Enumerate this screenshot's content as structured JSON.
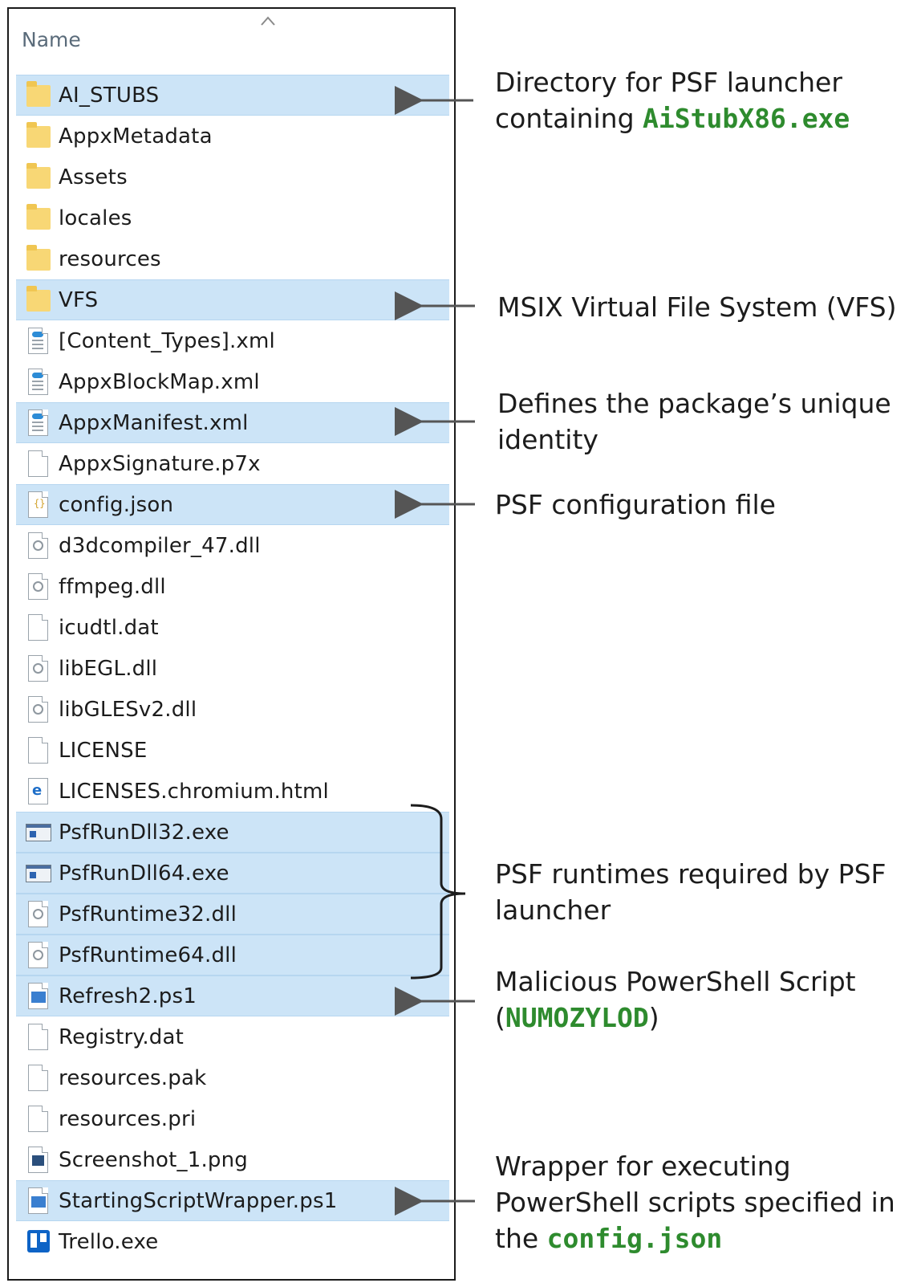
{
  "header": {
    "column_name": "Name"
  },
  "files": [
    {
      "name": "AI_STUBS",
      "icon": "folder-icon",
      "highlight": true
    },
    {
      "name": "AppxMetadata",
      "icon": "folder-icon",
      "highlight": false
    },
    {
      "name": "Assets",
      "icon": "folder-icon",
      "highlight": false
    },
    {
      "name": "locales",
      "icon": "folder-icon",
      "highlight": false
    },
    {
      "name": "resources",
      "icon": "folder-icon",
      "highlight": false
    },
    {
      "name": "VFS",
      "icon": "folder-icon",
      "highlight": true
    },
    {
      "name": "[Content_Types].xml",
      "icon": "xml-file-icon",
      "highlight": false
    },
    {
      "name": "AppxBlockMap.xml",
      "icon": "xml-file-icon",
      "highlight": false
    },
    {
      "name": "AppxManifest.xml",
      "icon": "xml-file-icon",
      "highlight": true
    },
    {
      "name": "AppxSignature.p7x",
      "icon": "blank-file-icon",
      "highlight": false
    },
    {
      "name": "config.json",
      "icon": "json-file-icon",
      "highlight": true
    },
    {
      "name": "d3dcompiler_47.dll",
      "icon": "dll-file-icon",
      "highlight": false
    },
    {
      "name": "ffmpeg.dll",
      "icon": "dll-file-icon",
      "highlight": false
    },
    {
      "name": "icudtl.dat",
      "icon": "blank-file-icon",
      "highlight": false
    },
    {
      "name": "libEGL.dll",
      "icon": "dll-file-icon",
      "highlight": false
    },
    {
      "name": "libGLESv2.dll",
      "icon": "dll-file-icon",
      "highlight": false
    },
    {
      "name": "LICENSE",
      "icon": "blank-file-icon",
      "highlight": false
    },
    {
      "name": "LICENSES.chromium.html",
      "icon": "html-file-icon",
      "highlight": false
    },
    {
      "name": "PsfRunDll32.exe",
      "icon": "exe-file-icon",
      "highlight": true
    },
    {
      "name": "PsfRunDll64.exe",
      "icon": "exe-file-icon",
      "highlight": true
    },
    {
      "name": "PsfRuntime32.dll",
      "icon": "dll-file-icon",
      "highlight": true
    },
    {
      "name": "PsfRuntime64.dll",
      "icon": "dll-file-icon",
      "highlight": true
    },
    {
      "name": "Refresh2.ps1",
      "icon": "powershell-file-icon",
      "highlight": true
    },
    {
      "name": "Registry.dat",
      "icon": "blank-file-icon",
      "highlight": false
    },
    {
      "name": "resources.pak",
      "icon": "blank-file-icon",
      "highlight": false
    },
    {
      "name": "resources.pri",
      "icon": "blank-file-icon",
      "highlight": false
    },
    {
      "name": "Screenshot_1.png",
      "icon": "image-file-icon",
      "highlight": false
    },
    {
      "name": "StartingScriptWrapper.ps1",
      "icon": "powershell-file-icon",
      "highlight": true
    },
    {
      "name": "Trello.exe",
      "icon": "trello-icon",
      "highlight": false
    }
  ],
  "annotations": {
    "ai_stubs": {
      "line1": "Directory for PSF launcher",
      "line2_prefix": "containing ",
      "line2_code": "AiStubX86.exe"
    },
    "vfs": {
      "line1": "MSIX Virtual File System (VFS)"
    },
    "manifest": {
      "line1": "Defines the package’s unique",
      "line2": "identity"
    },
    "config": {
      "line1": "PSF configuration file"
    },
    "runtimes": {
      "line1": "PSF runtimes required by PSF",
      "line2": "launcher"
    },
    "refresh": {
      "line1": "Malicious PowerShell Script",
      "line2_open": "(",
      "line2_code": "NUMOZYLOD",
      "line2_close": ")"
    },
    "wrapper": {
      "line1": "Wrapper for executing",
      "line2": "PowerShell scripts specified in",
      "line3_prefix": "the ",
      "line3_code": "config.json"
    }
  },
  "colors": {
    "highlight": "#cce4f7",
    "code_text": "#2e8b2e",
    "arrow": "#555555"
  }
}
